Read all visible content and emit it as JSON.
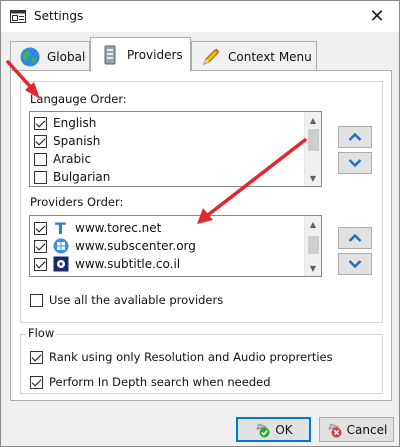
{
  "window": {
    "title": "Settings",
    "close_glyph": "✕"
  },
  "tabs": [
    {
      "label": "Global",
      "icon": "globe-icon",
      "active": false
    },
    {
      "label": "Providers",
      "icon": "server-icon",
      "active": true
    },
    {
      "label": "Context Menu",
      "icon": "pencil-icon",
      "active": false
    }
  ],
  "language_order": {
    "label": "Langauge Order:",
    "items": [
      {
        "label": "English",
        "checked": true
      },
      {
        "label": "Spanish",
        "checked": true
      },
      {
        "label": "Arabic",
        "checked": false
      },
      {
        "label": "Bulgarian",
        "checked": false
      }
    ]
  },
  "providers_order": {
    "label": "Providers Order:",
    "items": [
      {
        "label": "www.torec.net",
        "checked": true,
        "icon": "torec-t-icon"
      },
      {
        "label": "www.subscenter.org",
        "checked": true,
        "icon": "windows-logo-icon"
      },
      {
        "label": "www.subtitle.co.il",
        "checked": true,
        "icon": "film-reel-icon"
      }
    ]
  },
  "use_all_providers": {
    "label": "Use all the avaliable providers",
    "checked": false
  },
  "flow": {
    "label": "Flow",
    "rank_option": {
      "label": "Rank using only Resolution and Audio proprerties",
      "checked": true
    },
    "depth_option": {
      "label": "Perform In Depth search when needed",
      "checked": true
    }
  },
  "buttons": {
    "ok": "OK",
    "cancel": "Cancel"
  },
  "colors": {
    "accent": "#0078d7",
    "annotation_arrow": "#e0282e",
    "move_arrow": "#1e6fc2"
  }
}
